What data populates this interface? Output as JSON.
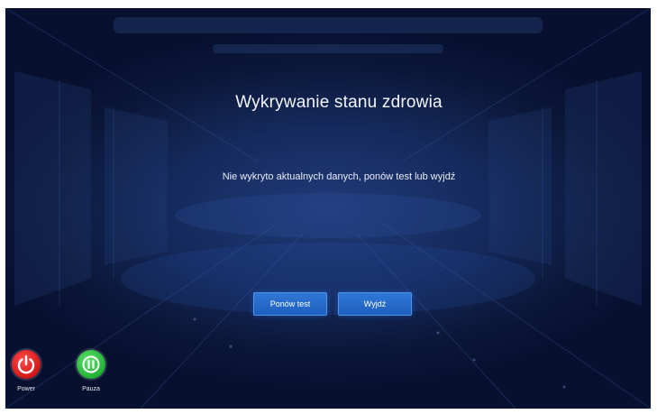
{
  "dialog": {
    "title": "Wykrywanie stanu zdrowia",
    "message": "Nie wykryto aktualnych danych, ponów test lub wyjdź"
  },
  "actions": {
    "retry_label": "Ponów test",
    "exit_label": "Wyjdź"
  },
  "footer": {
    "power_label": "Power",
    "pause_label": "Pauza"
  },
  "icons": {
    "power": "power-icon",
    "pause": "pause-icon"
  },
  "colors": {
    "background": "#152a5d",
    "button_primary": "#1e5fbf",
    "power": "#d01818",
    "pause": "#21b135"
  }
}
